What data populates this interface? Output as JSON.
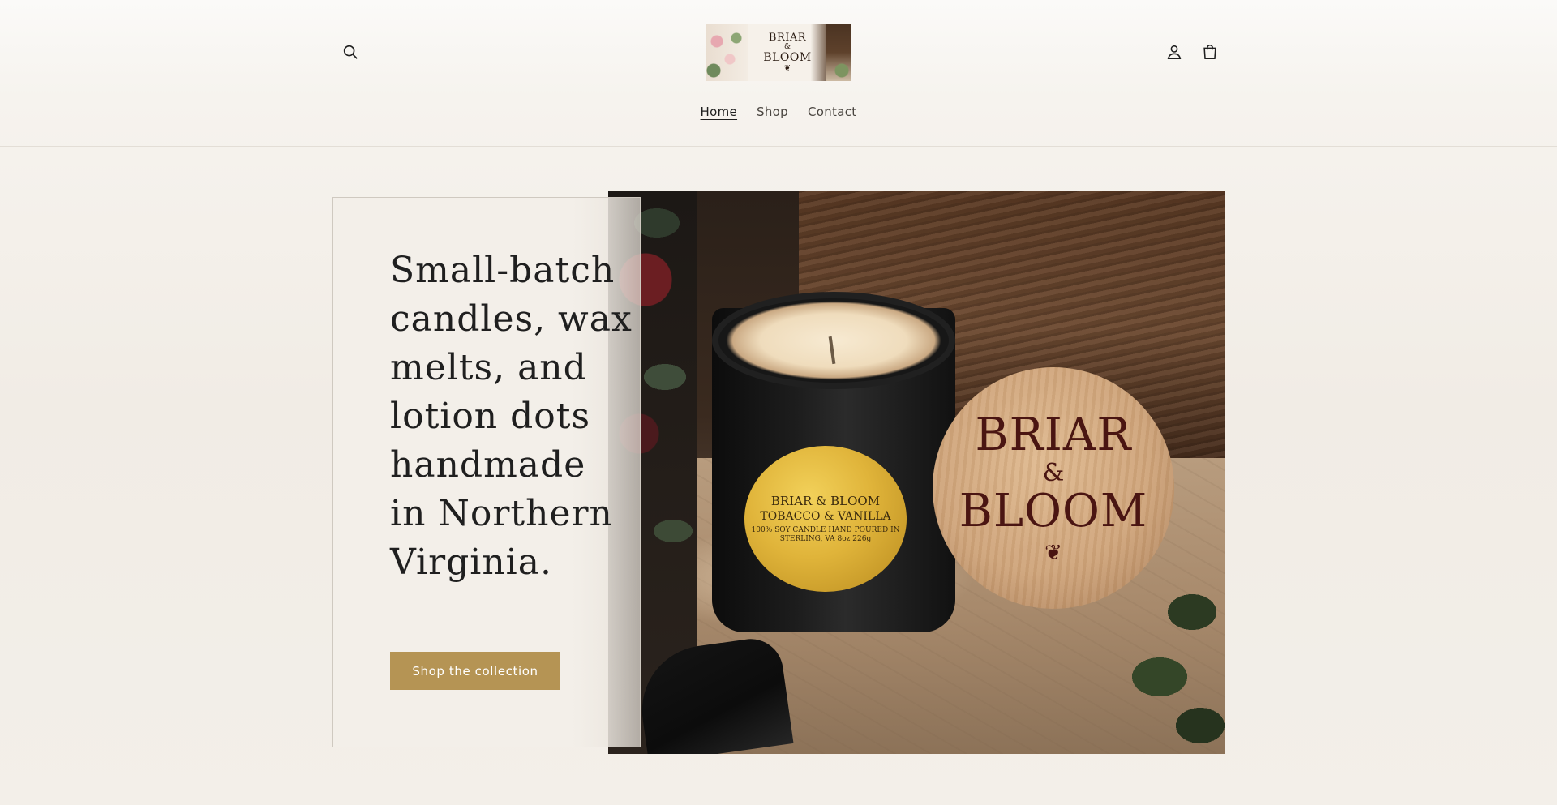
{
  "header": {
    "search_icon": "search-icon",
    "account_icon": "user-icon",
    "cart_icon": "cart-icon",
    "logo": {
      "line1": "BRIAR",
      "line2": "&",
      "line3": "BLOOM",
      "flourish": "❦"
    }
  },
  "nav": {
    "items": [
      {
        "label": "Home",
        "active": true
      },
      {
        "label": "Shop",
        "active": false
      },
      {
        "label": "Contact",
        "active": false
      }
    ]
  },
  "hero": {
    "headline": "Small-batch candles, wax melts, and lotion dots handmade in Northern Virginia.",
    "cta_label": "Shop the collection",
    "image": {
      "label_brand": "BRIAR & BLOOM",
      "label_scent": "TOBACCO & VANILLA",
      "label_detail": "100% SOY CANDLE HAND POURED IN STERLING, VA 8oz 226g",
      "lid_line1": "BRIAR",
      "lid_line2": "&",
      "lid_line3": "BLOOM",
      "lid_flourish": "❦"
    }
  },
  "colors": {
    "accent": "#b59454",
    "background": "#f3efe9",
    "text": "#1f1f1f"
  }
}
